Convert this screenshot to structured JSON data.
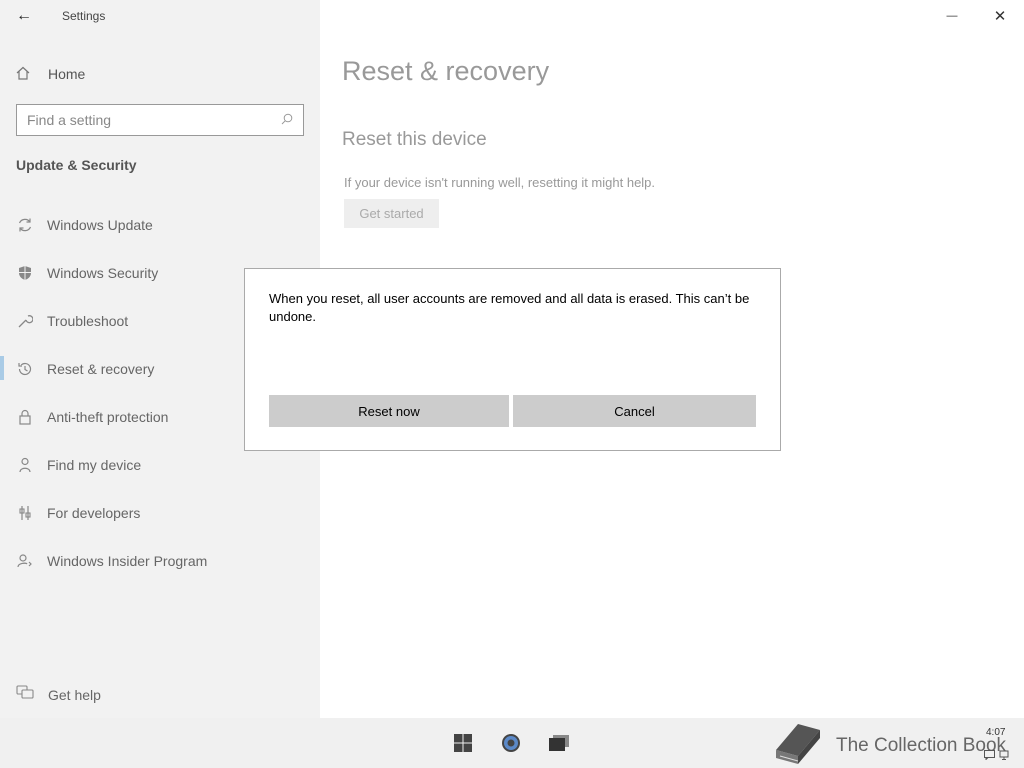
{
  "window": {
    "title": "Settings",
    "back_glyph": "←",
    "minimize_glyph": "—",
    "close_glyph": "✕"
  },
  "sidebar": {
    "home_label": "Home",
    "search_placeholder": "Find a setting",
    "section_title": "Update & Security",
    "items": [
      {
        "label": "Windows Update",
        "icon": "sync-icon",
        "active": false
      },
      {
        "label": "Windows Security",
        "icon": "shield-icon",
        "active": false
      },
      {
        "label": "Troubleshoot",
        "icon": "wrench-icon",
        "active": false
      },
      {
        "label": "Reset & recovery",
        "icon": "history-icon",
        "active": true
      },
      {
        "label": "Anti-theft protection",
        "icon": "lock-icon",
        "active": false
      },
      {
        "label": "Find my device",
        "icon": "person-icon",
        "active": false
      },
      {
        "label": "For developers",
        "icon": "developer-tools-icon",
        "active": false
      },
      {
        "label": "Windows Insider Program",
        "icon": "insider-icon",
        "active": false
      }
    ],
    "get_help_label": "Get help"
  },
  "main": {
    "page_title": "Reset & recovery",
    "section_title": "Reset this device",
    "description": "If your device isn't running well, resetting it might help.",
    "get_started_label": "Get started"
  },
  "dialog": {
    "message": "When you reset, all user accounts are removed and all data is erased. This can’t be undone.",
    "confirm_label": "Reset now",
    "cancel_label": "Cancel"
  },
  "taskbar": {
    "watermark_text": "The Collection Book",
    "clock": "4:07",
    "icons": [
      "windows-start-icon",
      "settings-gear-icon",
      "task-view-icon"
    ]
  },
  "colors": {
    "accent": "#a9cbe6",
    "sidebar_bg": "#f2f2f2",
    "button_bg": "#cccccc"
  }
}
